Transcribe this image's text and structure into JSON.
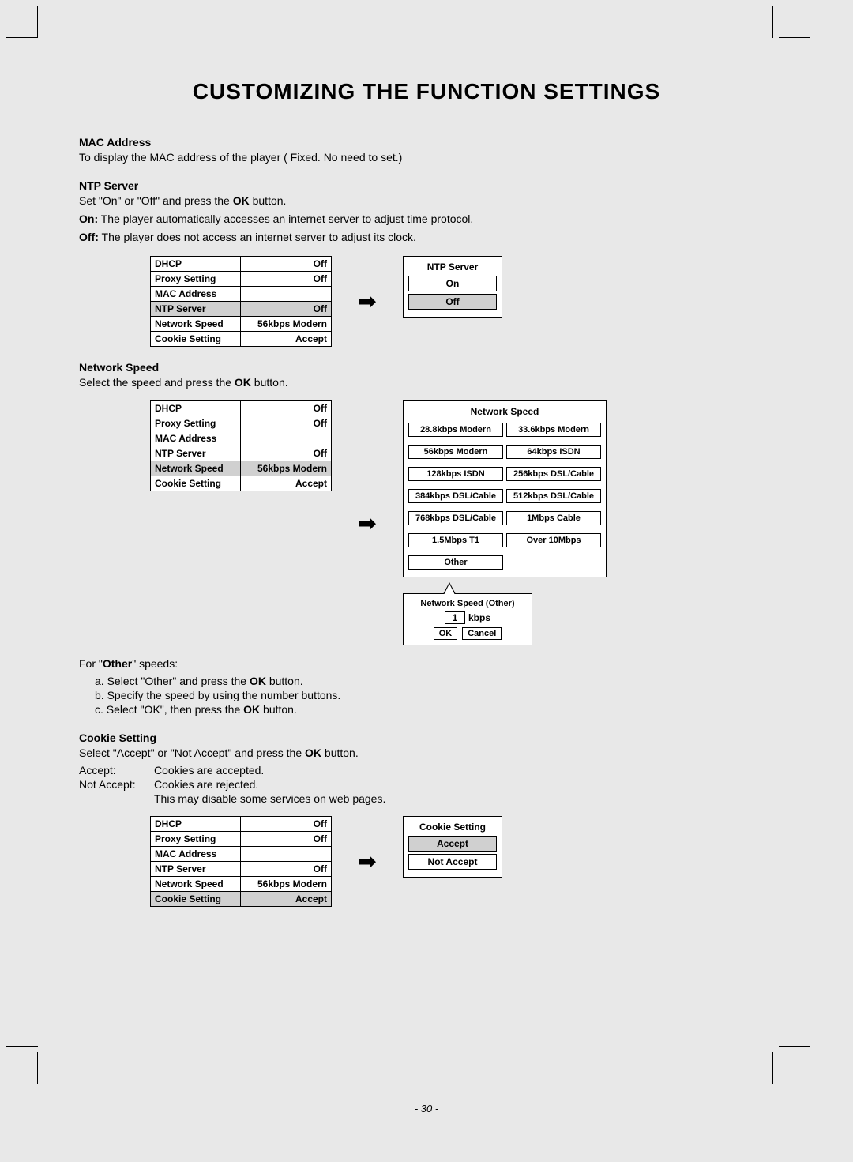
{
  "title": "CUSTOMIZING THE FUNCTION SETTINGS",
  "mac": {
    "heading": "MAC Address",
    "body": "To display the MAC address of the player ( Fixed. No need to set.)"
  },
  "ntp": {
    "heading": "NTP Server",
    "line1_a": "Set \"On\" or \"Off\" and press the ",
    "line1_b": "OK",
    "line1_c": " button.",
    "on_label": "On:",
    "on_text": " The player automatically accesses an internet server to adjust time protocol.",
    "off_label": "Off:",
    "off_text": " The player does not access an internet server to adjust its clock.",
    "popup_title": "NTP Server",
    "opt_on": "On",
    "opt_off": "Off"
  },
  "menu": {
    "rows": [
      {
        "label": "DHCP",
        "value": "Off"
      },
      {
        "label": "Proxy Setting",
        "value": "Off"
      },
      {
        "label": "MAC Address",
        "value": ""
      },
      {
        "label": "NTP Server",
        "value": "Off"
      },
      {
        "label": "Network Speed",
        "value": "56kbps Modern"
      },
      {
        "label": "Cookie Setting",
        "value": "Accept"
      }
    ]
  },
  "netspeed": {
    "heading": "Network Speed",
    "body_a": "Select the speed and press the ",
    "body_b": "OK",
    "body_c": " button.",
    "popup_title": "Network Speed",
    "options": [
      "28.8kbps Modern",
      "33.6kbps Modern",
      "56kbps Modern",
      "64kbps ISDN",
      "128kbps ISDN",
      "256kbps DSL/Cable",
      "384kbps DSL/Cable",
      "512kbps DSL/Cable",
      "768kbps DSL/Cable",
      "1Mbps Cable",
      "1.5Mbps T1",
      "Over 10Mbps"
    ],
    "option_other": "Other",
    "other_title": "Network Speed (Other)",
    "kbps_value": "1",
    "kbps_label": "kbps",
    "btn_ok": "OK",
    "btn_cancel": "Cancel",
    "for_other_a": "For \"",
    "for_other_b": "Other",
    "for_other_c": "\" speeds:",
    "step_a_1": "a. Select \"Other\" and press the ",
    "step_a_2": "OK",
    "step_a_3": " button.",
    "step_b": "b. Specify the speed by using the number buttons.",
    "step_c_1": "c. Select \"OK\", then press the ",
    "step_c_2": "OK",
    "step_c_3": " button."
  },
  "cookie": {
    "heading": "Cookie Setting",
    "body_a": "Select \"Accept\" or \"Not Accept\" and press the ",
    "body_b": "OK",
    "body_c": " button.",
    "accept_lbl": "Accept:",
    "accept_txt": "Cookies are accepted.",
    "naccept_lbl": "Not Accept:",
    "naccept_txt": "Cookies are rejected.",
    "extra": "This may disable some services on web pages.",
    "popup_title": "Cookie Setting",
    "opt_accept": "Accept",
    "opt_naccept": "Not Accept"
  },
  "page_num": "- 30 -"
}
